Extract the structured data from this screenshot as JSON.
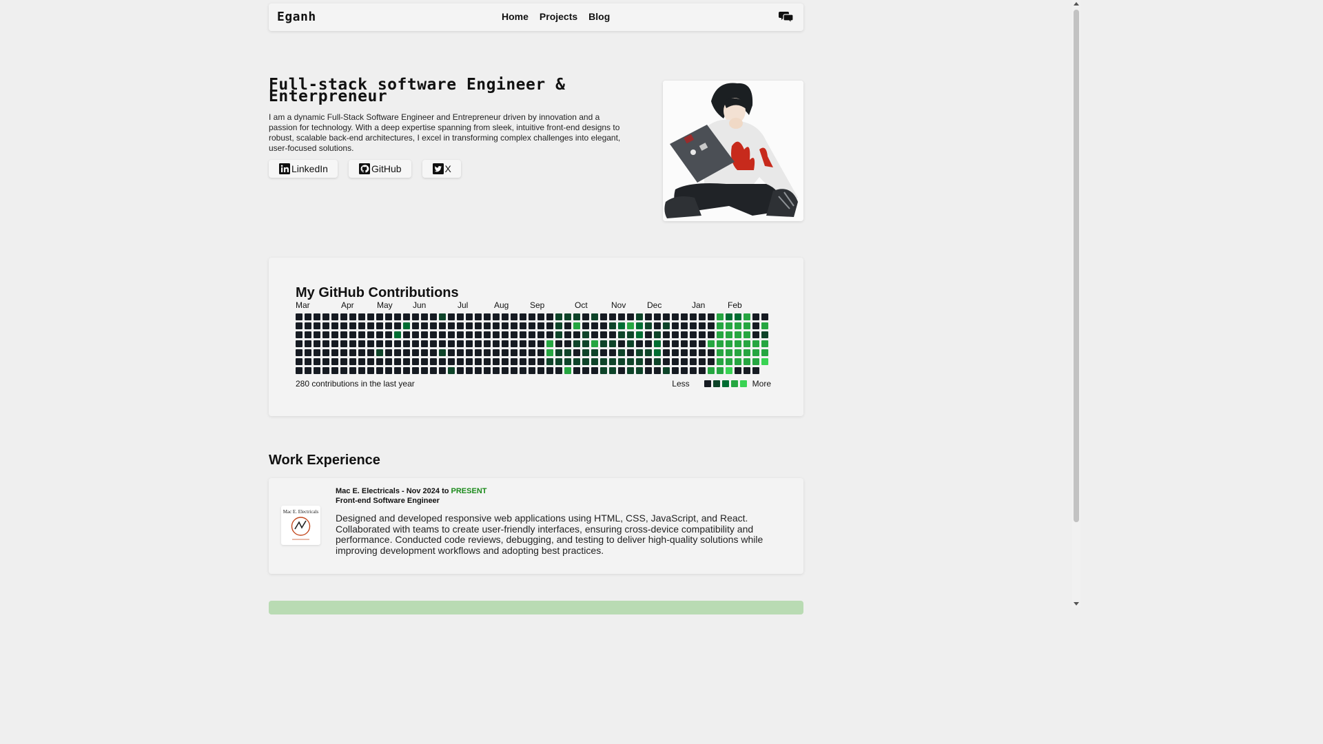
{
  "nav": {
    "brand": "Eganh",
    "links": [
      "Home",
      "Projects",
      "Blog"
    ],
    "chat_icon": "chat-bubbles-icon"
  },
  "hero": {
    "title": "Full-stack software Engineer & Enterpreneur",
    "description": "I am a dynamic Full-Stack Software Engineer and Entrepreneur driven by innovation and a passion for technology. With a deep expertise spanning from sleek, intuitive front-end designs to robust, scalable back-end architectures, I excel in transforming complex challenges into elegant, user-focused solutions.",
    "socials": [
      {
        "label": "LinkedIn",
        "icon": "linkedin-icon"
      },
      {
        "label": "GitHub",
        "icon": "github-icon"
      },
      {
        "label": "X",
        "icon": "twitter-icon"
      }
    ],
    "avatar_icon": "anime-avatar-illustration"
  },
  "contributions": {
    "title": "My GitHub Contributions",
    "months": [
      "Mar",
      "Apr",
      "May",
      "Jun",
      "Jul",
      "Aug",
      "Sep",
      "Oct",
      "Nov",
      "Dec",
      "Jan",
      "Feb"
    ],
    "summary": "280 contributions in the last year",
    "legend_less": "Less",
    "legend_more": "More",
    "colors": [
      "#161b22",
      "#0e4429",
      "#006d32",
      "#26a641",
      "#39d353"
    ],
    "active_cells": [
      [
        9,
        4,
        1
      ],
      [
        11,
        2,
        2
      ],
      [
        12,
        1,
        2
      ],
      [
        16,
        0,
        1
      ],
      [
        16,
        4,
        1
      ],
      [
        17,
        6,
        1
      ],
      [
        28,
        3,
        3
      ],
      [
        28,
        4,
        3
      ],
      [
        28,
        5,
        1
      ],
      [
        29,
        0,
        1
      ],
      [
        29,
        1,
        1
      ],
      [
        29,
        2,
        1
      ],
      [
        29,
        4,
        1
      ],
      [
        29,
        5,
        1
      ],
      [
        30,
        0,
        1
      ],
      [
        30,
        4,
        1
      ],
      [
        30,
        5,
        1
      ],
      [
        30,
        6,
        3
      ],
      [
        31,
        0,
        1
      ],
      [
        31,
        1,
        3
      ],
      [
        31,
        3,
        1
      ],
      [
        31,
        5,
        1
      ],
      [
        32,
        2,
        1
      ],
      [
        32,
        3,
        1
      ],
      [
        32,
        4,
        1
      ],
      [
        32,
        5,
        1
      ],
      [
        33,
        0,
        1
      ],
      [
        33,
        3,
        3
      ],
      [
        33,
        4,
        1
      ],
      [
        33,
        5,
        1
      ],
      [
        34,
        3,
        1
      ],
      [
        34,
        5,
        1
      ],
      [
        34,
        6,
        1
      ],
      [
        35,
        1,
        1
      ],
      [
        35,
        3,
        1
      ],
      [
        35,
        5,
        1
      ],
      [
        35,
        6,
        1
      ],
      [
        36,
        1,
        2
      ],
      [
        36,
        2,
        1
      ],
      [
        36,
        4,
        1
      ],
      [
        36,
        5,
        1
      ],
      [
        37,
        1,
        3
      ],
      [
        37,
        2,
        1
      ],
      [
        37,
        3,
        1
      ],
      [
        37,
        5,
        1
      ],
      [
        37,
        6,
        1
      ],
      [
        38,
        0,
        1
      ],
      [
        38,
        1,
        2
      ],
      [
        38,
        2,
        2
      ],
      [
        38,
        4,
        1
      ],
      [
        38,
        5,
        1
      ],
      [
        38,
        6,
        1
      ],
      [
        39,
        1,
        1
      ],
      [
        39,
        4,
        1
      ],
      [
        40,
        2,
        1
      ],
      [
        40,
        3,
        2
      ],
      [
        40,
        4,
        2
      ],
      [
        40,
        5,
        1
      ],
      [
        41,
        1,
        1
      ],
      [
        41,
        6,
        1
      ],
      [
        46,
        3,
        3
      ],
      [
        46,
        6,
        3
      ],
      [
        47,
        0,
        3
      ],
      [
        47,
        1,
        3
      ],
      [
        47,
        2,
        3
      ],
      [
        47,
        3,
        3
      ],
      [
        47,
        4,
        3
      ],
      [
        47,
        5,
        3
      ],
      [
        47,
        6,
        3
      ],
      [
        48,
        0,
        2
      ],
      [
        48,
        1,
        3
      ],
      [
        48,
        2,
        3
      ],
      [
        48,
        3,
        3
      ],
      [
        48,
        4,
        3
      ],
      [
        48,
        5,
        3
      ],
      [
        48,
        6,
        4
      ],
      [
        49,
        0,
        2
      ],
      [
        49,
        1,
        3
      ],
      [
        49,
        2,
        3
      ],
      [
        49,
        3,
        3
      ],
      [
        49,
        4,
        3
      ],
      [
        49,
        5,
        3
      ],
      [
        50,
        0,
        3
      ],
      [
        50,
        1,
        3
      ],
      [
        50,
        2,
        3
      ],
      [
        50,
        3,
        3
      ],
      [
        50,
        4,
        3
      ],
      [
        50,
        5,
        3
      ],
      [
        51,
        3,
        3
      ],
      [
        51,
        4,
        3
      ],
      [
        51,
        5,
        3
      ],
      [
        52,
        1,
        3
      ],
      [
        52,
        2,
        1
      ],
      [
        52,
        3,
        3
      ],
      [
        52,
        4,
        3
      ],
      [
        52,
        5,
        4
      ]
    ]
  },
  "work": {
    "heading": "Work Experience",
    "jobs": [
      {
        "company_line": "Mac E. Electricals - Nov 2024 to",
        "present": "PRESENT",
        "role": "Front-end Software Engineer",
        "logo_text": "Mac E. Electricals",
        "description": "Designed and developed responsive web applications using HTML, CSS, JavaScript, and React. Collaborated with teams to create user-friendly interfaces, ensuring cross-device compatibility and performance. Conducted code reviews, debugging, and testing to deliver high-quality solutions while improving development workflows and adopting best practices."
      }
    ]
  }
}
